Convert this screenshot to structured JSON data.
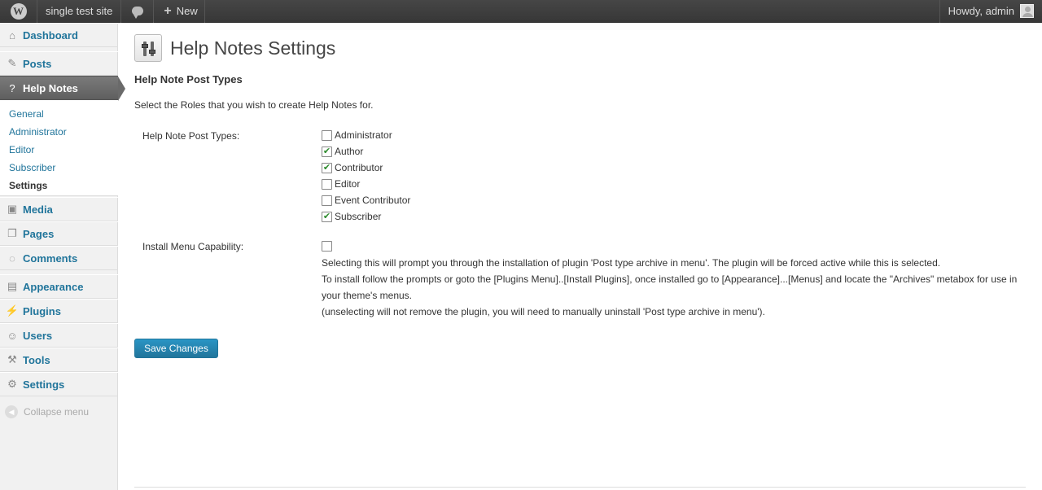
{
  "admin_bar": {
    "site_name": "single test site",
    "new_label": "New",
    "howdy": "Howdy, admin",
    "icons": [
      "wordpress-logo-icon",
      "comment-bubble-icon",
      "plus-icon",
      "avatar-icon"
    ]
  },
  "sidebar": {
    "items": [
      {
        "label": "Dashboard",
        "icon": "dashboard-icon"
      },
      {
        "label": "Posts",
        "icon": "pushpin-icon"
      },
      {
        "label": "Help Notes",
        "icon": "question-icon"
      },
      {
        "label": "Media",
        "icon": "media-icon"
      },
      {
        "label": "Pages",
        "icon": "pages-icon"
      },
      {
        "label": "Comments",
        "icon": "comments-icon"
      },
      {
        "label": "Appearance",
        "icon": "appearance-icon"
      },
      {
        "label": "Plugins",
        "icon": "plugins-icon"
      },
      {
        "label": "Users",
        "icon": "users-icon"
      },
      {
        "label": "Tools",
        "icon": "tools-icon"
      },
      {
        "label": "Settings",
        "icon": "settings-icon"
      }
    ],
    "submenu": [
      "General",
      "Administrator",
      "Editor",
      "Subscriber",
      "Settings"
    ],
    "collapse_label": "Collapse menu"
  },
  "main": {
    "title": "Help Notes Settings",
    "section_title": "Help Note Post Types",
    "intro": "Select the Roles that you wish to create Help Notes for.",
    "post_types_label": "Help Note Post Types:",
    "roles": [
      {
        "label": "Administrator",
        "checked": false
      },
      {
        "label": "Author",
        "checked": true
      },
      {
        "label": "Contributor",
        "checked": true
      },
      {
        "label": "Editor",
        "checked": false
      },
      {
        "label": "Event Contributor",
        "checked": false
      },
      {
        "label": "Subscriber",
        "checked": true
      }
    ],
    "install_label": "Install Menu Capability:",
    "install_checked": false,
    "install_desc": [
      "Selecting this will prompt you through the installation of plugin 'Post type archive in menu'. The plugin will be forced active while this is selected.",
      "To install follow the prompts or goto the [Plugins Menu]..[Install Plugins], once installed go to [Appearance]...[Menus] and locate the \"Archives\" metabox for use in your theme's menus.",
      "(unselecting will not remove the plugin, you will need to manually uninstall 'Post type archive in menu')."
    ],
    "save_label": "Save Changes"
  },
  "colors": {
    "link": "#21759b",
    "admin_bar": "#464646",
    "current_menu": "#6a6a6a",
    "check": "#2b8a2b"
  }
}
